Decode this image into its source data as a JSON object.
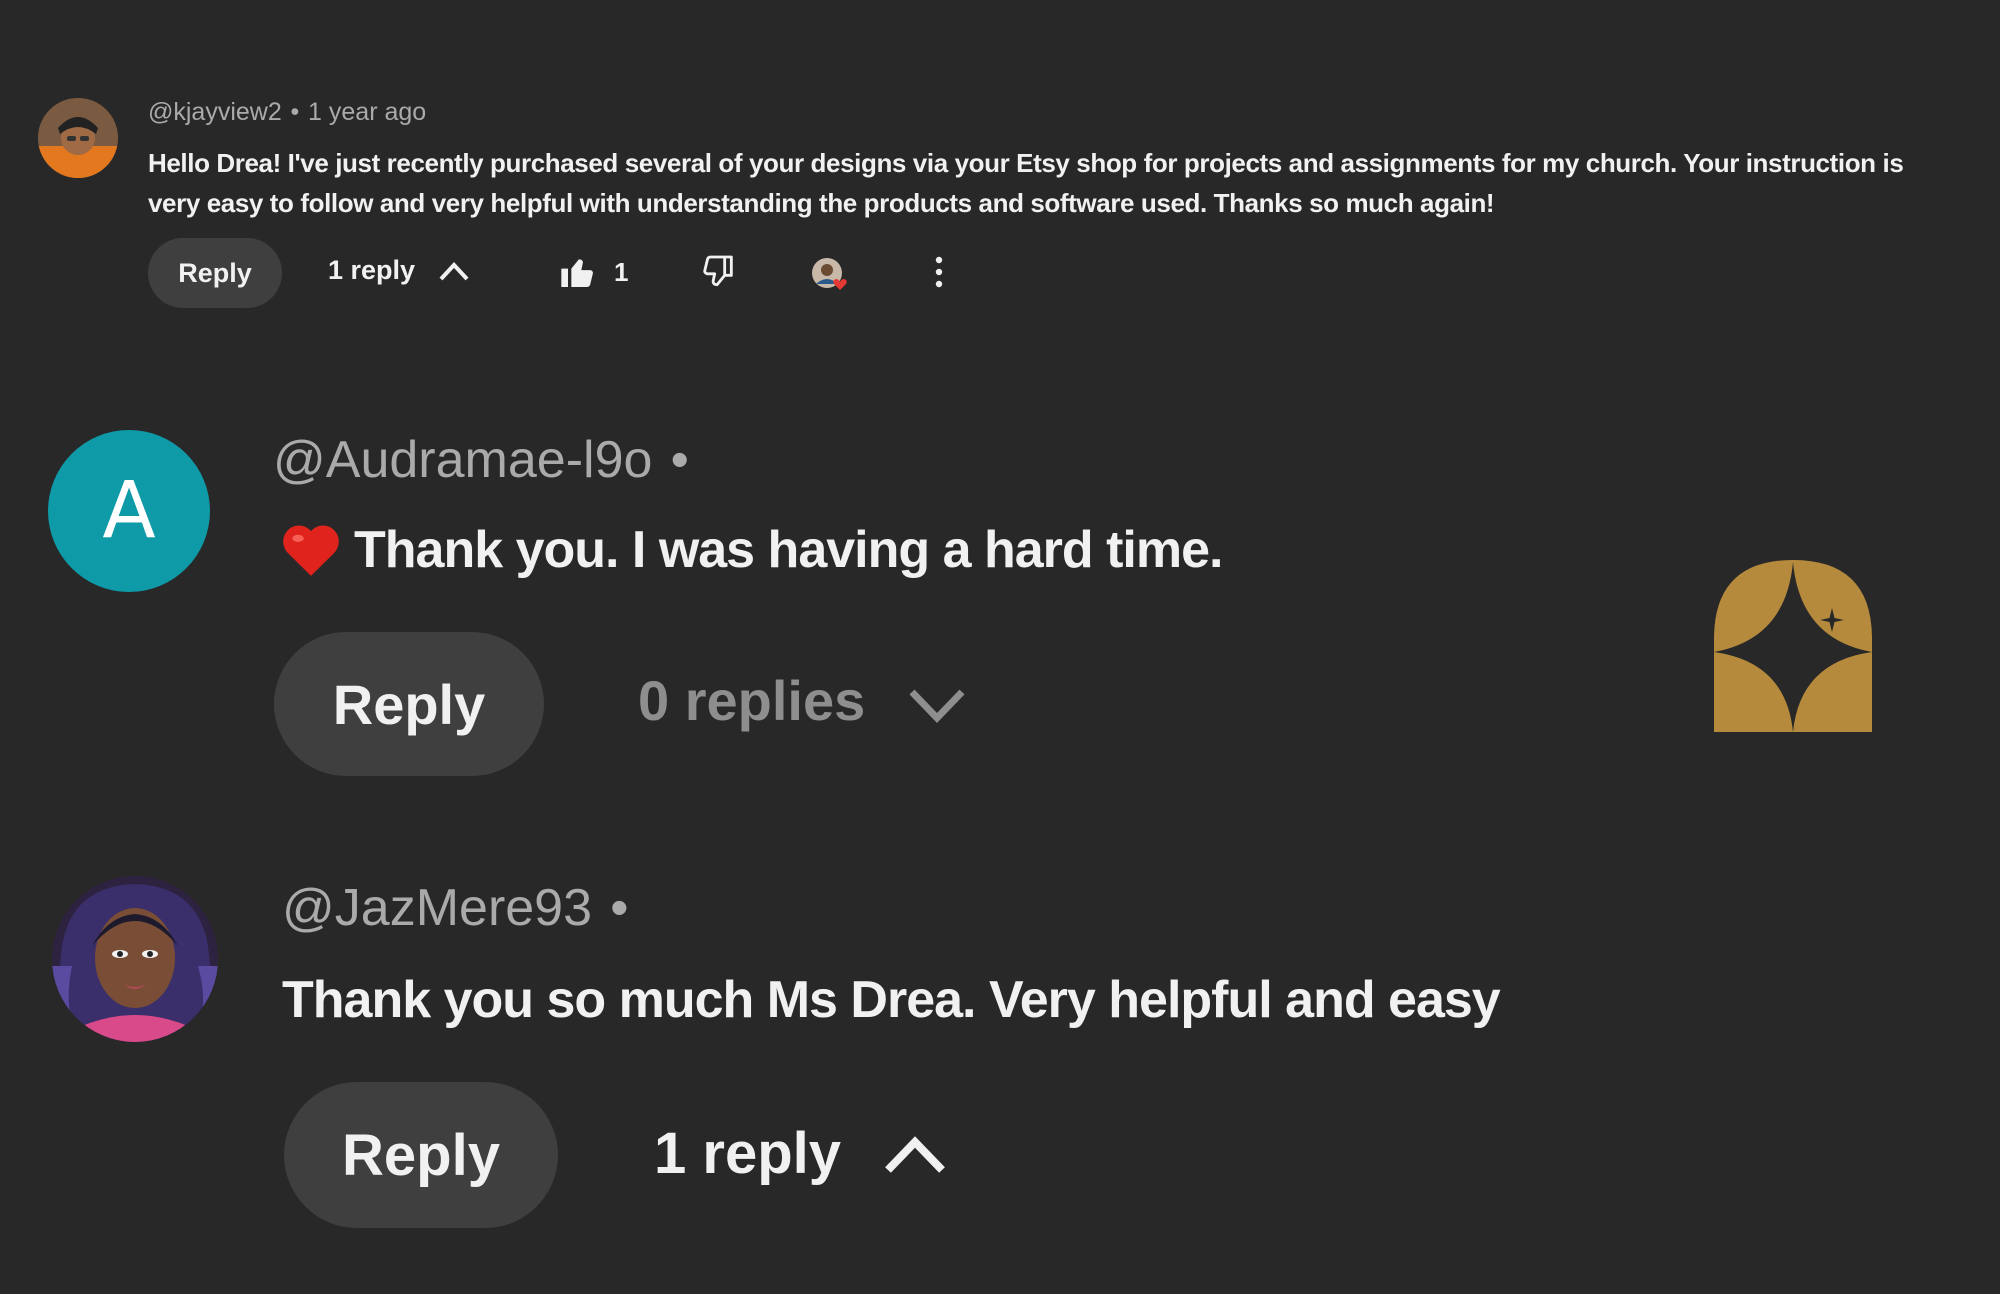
{
  "comments": [
    {
      "handle": "@kjayview2",
      "separator": "•",
      "time": "1 year ago",
      "text": "Hello Drea! I've just recently purchased several of your designs via your Etsy shop for projects and assignments for my church. Your instruction is very easy to follow and very helpful with understanding the products and software used.  Thanks so much again!",
      "reply_label": "Reply",
      "replies_label": "1 reply",
      "replies_expanded": true,
      "like_count": "1",
      "icons": [
        "thumbs-up-icon",
        "thumbs-down-icon",
        "creator-heart-icon",
        "more-vert-icon",
        "chevron-up-icon"
      ]
    },
    {
      "handle": "@Audramae-l9o",
      "separator": "•",
      "avatar_letter": "A",
      "text": "Thank you. I was having a hard time.",
      "emoji": "red-heart",
      "reply_label": "Reply",
      "replies_label": "0 replies",
      "replies_expanded": false,
      "icons": [
        "chevron-down-icon"
      ]
    },
    {
      "handle": "@JazMere93",
      "separator": "•",
      "text": "Thank you so much Ms Drea. Very helpful and easy",
      "reply_label": "Reply",
      "replies_label": "1 reply",
      "replies_expanded": true,
      "icons": [
        "chevron-up-icon"
      ]
    }
  ],
  "badge": {
    "icon": "sparkle-badge-icon",
    "color": "#b58a3c"
  },
  "colors": {
    "background": "#282828",
    "button": "#3f3f3f",
    "meta_text": "#aaaaaa",
    "avatar_a": "#0e9aa7",
    "heart_red": "#e53935"
  }
}
